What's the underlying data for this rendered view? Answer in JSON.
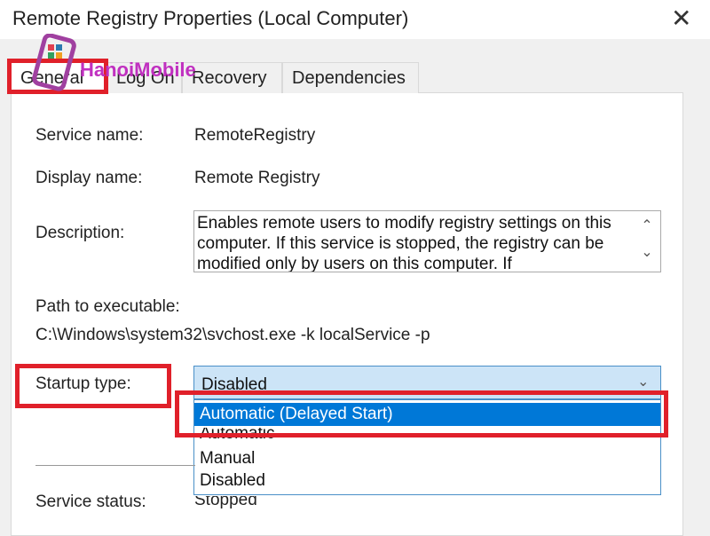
{
  "window": {
    "title": "Remote Registry Properties (Local Computer)",
    "close_icon": "close-icon"
  },
  "tabs": [
    {
      "label": "General",
      "active": true
    },
    {
      "label": "Log On"
    },
    {
      "label": "Recovery"
    },
    {
      "label": "Dependencies"
    }
  ],
  "general": {
    "service_name_label": "Service name:",
    "service_name": "RemoteRegistry",
    "display_name_label": "Display name:",
    "display_name": "Remote Registry",
    "description_label": "Description:",
    "description": "Enables remote users to modify registry settings on this computer. If this service is stopped, the registry can be modified only by users on this computer. If",
    "path_label": "Path to executable:",
    "path": "C:\\Windows\\system32\\svchost.exe -k localService -p",
    "startup_label": "Startup type:",
    "startup_value": "Disabled",
    "startup_options": [
      "Automatic (Delayed Start)",
      "Automatic",
      "Manual",
      "Disabled"
    ],
    "highlighted_option": "Automatic (Delayed Start)",
    "status_label": "Service status:",
    "status": "Stopped"
  },
  "watermark": "HanoiMobile",
  "colors": {
    "highlight": "#0078d7",
    "annotation": "#e0202a",
    "combo_bg": "#cce4f7"
  }
}
